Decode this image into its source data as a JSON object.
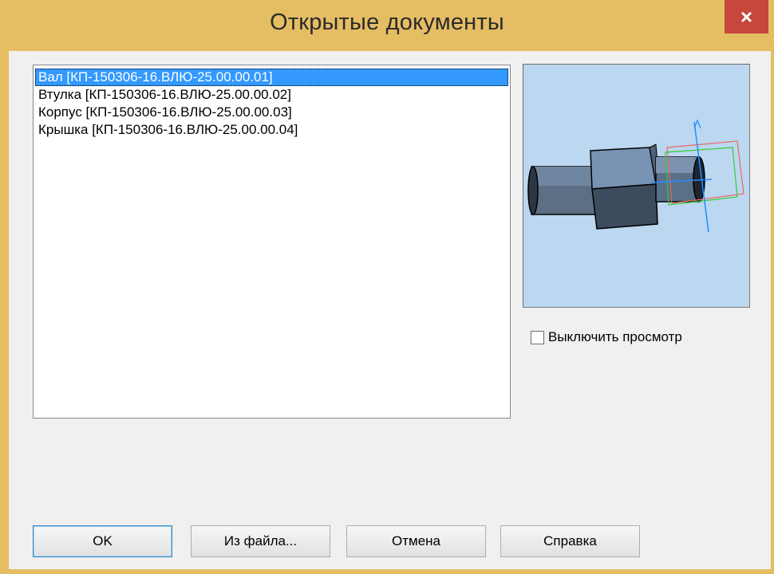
{
  "window": {
    "title": "Открытые документы",
    "close_glyph": "×"
  },
  "documents": [
    {
      "label": "Вал [КП-150306-16.ВЛЮ-25.00.00.01]",
      "selected": true
    },
    {
      "label": "Втулка [КП-150306-16.ВЛЮ-25.00.00.02]",
      "selected": false
    },
    {
      "label": "Корпус [КП-150306-16.ВЛЮ-25.00.00.03]",
      "selected": false
    },
    {
      "label": "Крышка [КП-150306-16.ВЛЮ-25.00.00.04]",
      "selected": false
    }
  ],
  "preview": {
    "disable_label": "Выключить просмотр",
    "disabled": false
  },
  "buttons": {
    "ok": "OK",
    "from_file": "Из файла...",
    "cancel": "Отмена",
    "help": "Справка"
  },
  "colors": {
    "frame": "#e5bd63",
    "close": "#c8463d",
    "selection": "#3399ff",
    "preview_bg": "#bcd7f0"
  }
}
